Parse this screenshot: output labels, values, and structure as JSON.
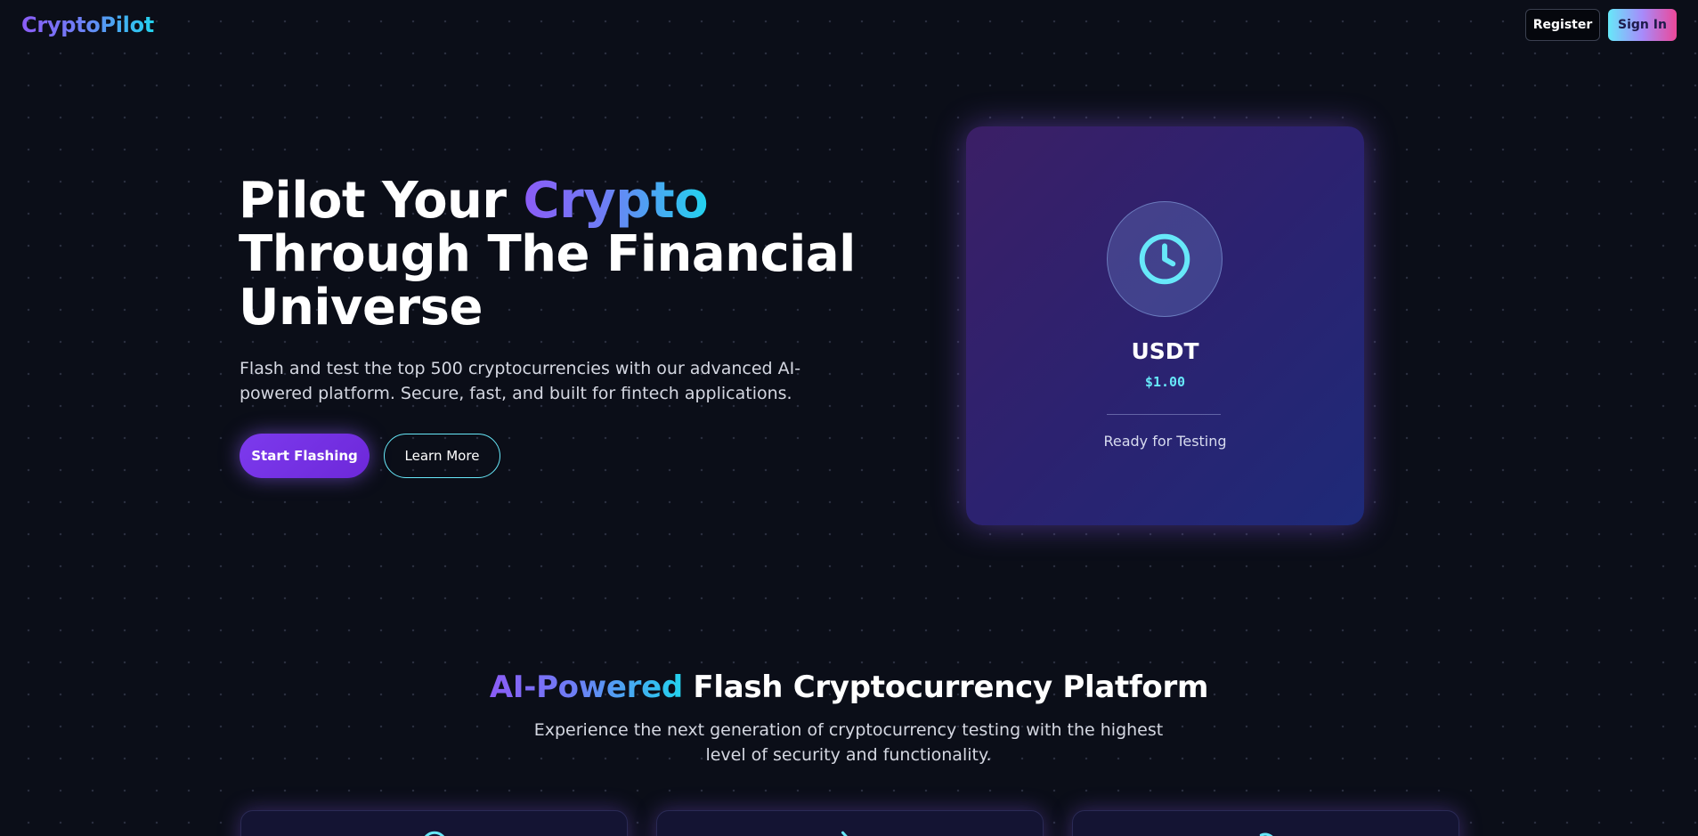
{
  "header": {
    "logo": "CryptoPilot",
    "register_label": "Register",
    "signin_label": "Sign In"
  },
  "hero": {
    "title_part1": "Pilot Your ",
    "title_highlight": "Crypto",
    "title_line2": "Through The Financial",
    "title_line3": "Universe",
    "description": "Flash and test the top 500 cryptocurrencies with our advanced AI-powered platform. Secure, fast, and built for fintech applications.",
    "start_label": "Start Flashing",
    "learn_label": "Learn More"
  },
  "coin_card": {
    "icon": "clock-icon",
    "name": "USDT",
    "price": "$1.00",
    "status": "Ready for Testing"
  },
  "features": {
    "title_highlight": "AI-Powered",
    "title_rest": " Flash Cryptocurrency Platform",
    "description": "Experience the next generation of cryptocurrency testing with the highest level of security and functionality.",
    "cards": [
      {
        "icon": "feature-icon-1"
      },
      {
        "icon": "feature-icon-2"
      },
      {
        "icon": "feature-icon-3"
      }
    ]
  },
  "colors": {
    "background": "#0b0e18",
    "accent_purple": "#8b5cf6",
    "accent_cyan": "#22d3ee",
    "price_cyan": "#67e8f9"
  }
}
